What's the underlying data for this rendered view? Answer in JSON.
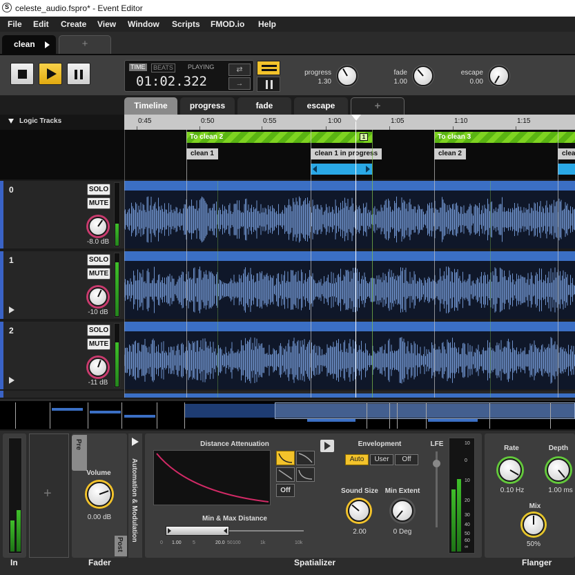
{
  "window": {
    "title": "celeste_audio.fspro* - Event Editor"
  },
  "menu": [
    "File",
    "Edit",
    "Create",
    "View",
    "Window",
    "Scripts",
    "FMOD.io",
    "Help"
  ],
  "event_tabs": {
    "active": "clean",
    "add": "+"
  },
  "transport": {
    "time_mode": "TIME",
    "beats_mode": "BEATS",
    "state": "PLAYING",
    "time": "01:02.322",
    "params": [
      {
        "label": "progress",
        "value": "1.30"
      },
      {
        "label": "fade",
        "value": "1.00"
      },
      {
        "label": "escape",
        "value": "0.00"
      }
    ]
  },
  "timeline_tabs": [
    "Timeline",
    "progress",
    "fade",
    "escape"
  ],
  "logic_tracks_label": "Logic Tracks",
  "ruler_ticks": [
    "0:45",
    "0:50",
    "0:55",
    "1:00",
    "1:05",
    "1:10",
    "1:15"
  ],
  "logic": {
    "regions": [
      "To clean 2",
      "To clean 3"
    ],
    "region_badge": "1",
    "markers": [
      "clean 1",
      "clean 1 in progress",
      "clean 2",
      "clea"
    ]
  },
  "tracks": [
    {
      "name": "0",
      "solo": "SOLO",
      "mute": "MUTE",
      "volume": "-8.0 dB",
      "meter_level": 0.35
    },
    {
      "name": "1",
      "solo": "SOLO",
      "mute": "MUTE",
      "volume": "-10 dB",
      "meter_level": 0.85
    },
    {
      "name": "2",
      "solo": "SOLO",
      "mute": "MUTE",
      "volume": "-11 dB",
      "meter_level": 0.7
    }
  ],
  "deck": {
    "input_label": "In",
    "add": "+",
    "fader": {
      "tab_pre": "Pre",
      "tab_post": "Post",
      "volume_label": "Volume",
      "volume_value": "0.00 dB",
      "section": "Fader"
    },
    "automation_label": "Automation & Modulation",
    "spatializer": {
      "distance_label": "Distance Attenuation",
      "off_label": "Off",
      "minmax_label": "Min & Max Distance",
      "scale": [
        "0",
        "1.00",
        "5",
        "20.0",
        "50",
        "100",
        "1k",
        "10k"
      ],
      "envelopment_label": "Envelopment",
      "env_modes": [
        "Auto",
        "User",
        "Off"
      ],
      "active_mode": "Auto",
      "sound_size_label": "Sound Size",
      "sound_size_value": "2.00",
      "min_extent_label": "Min Extent",
      "min_extent_value": "0 Deg",
      "lfe_label": "LFE",
      "meter_scale": [
        "10",
        "0",
        "10",
        "20",
        "30",
        "40",
        "50",
        "60",
        "∞"
      ],
      "section": "Spatializer"
    },
    "flanger": {
      "rate_label": "Rate",
      "rate_value": "0.10 Hz",
      "depth_label": "Depth",
      "depth_value": "1.00 ms",
      "mix_label": "Mix",
      "mix_value": "50%",
      "section": "Flanger"
    }
  },
  "colors": {
    "accent": "#f3c32b",
    "track_edge": "#3a63c6",
    "region_green": "#7ed321",
    "wave": "#6f93cd",
    "marker_blue": "#2aa8e6"
  }
}
